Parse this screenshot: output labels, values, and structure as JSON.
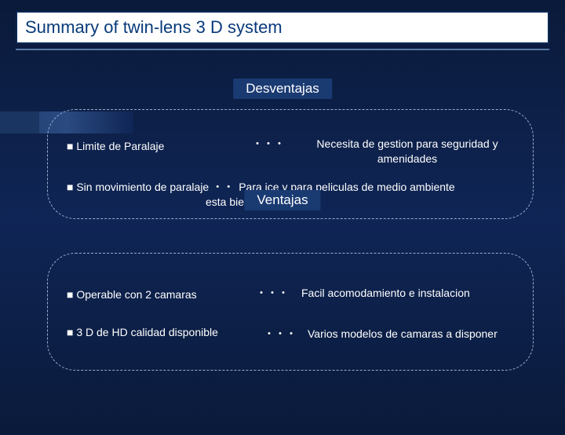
{
  "title": "Summary of twin-lens 3 D system",
  "sections": {
    "disadvantages": {
      "label": "Desventajas"
    },
    "advantages": {
      "label": "Ventajas"
    }
  },
  "dots": "・・・",
  "items": {
    "d1": {
      "lhs": "■ Limite de Paralaje",
      "rhs": "Necesita de gestion para seguridad y amenidades"
    },
    "d2": {
      "lhs": "■ Sin movimiento de paralaje",
      "dots": "・・",
      "rhs_a": "Para ice y para peliculas de medio ambiente",
      "rhs_b": "esta bien."
    },
    "a1": {
      "lhs": "■ Operable con 2 camaras",
      "rhs": "Facil acomodamiento e instalacion"
    },
    "a2": {
      "lhs": "■ 3 D de HD calidad disponible",
      "rhs": "Varios modelos de camaras a disponer"
    }
  }
}
